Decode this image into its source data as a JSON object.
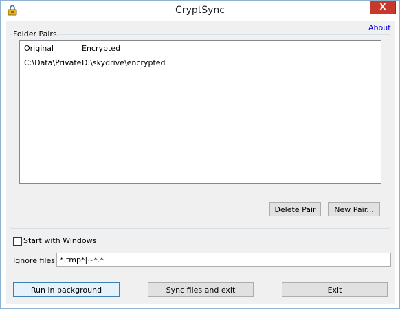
{
  "window": {
    "title": "CryptSync",
    "close_glyph": "X"
  },
  "about_link": "About",
  "folder_pairs": {
    "group_label": "Folder Pairs",
    "columns": [
      "Original",
      "Encrypted"
    ],
    "rows": [
      {
        "original": "C:\\Data\\Private",
        "encrypted": "D:\\skydrive\\encrypted"
      }
    ],
    "delete_button": "Delete Pair",
    "new_button": "New Pair..."
  },
  "options": {
    "start_with_windows_label": "Start with Windows",
    "start_with_windows_checked": false,
    "ignore_label": "Ignore files:",
    "ignore_value": "*.tmp*|~*.*"
  },
  "buttons": {
    "run_background": "Run in background",
    "sync_exit": "Sync files and exit",
    "exit": "Exit"
  },
  "colors": {
    "close_button": "#c7392a",
    "link": "#0000ee",
    "default_button_border": "#3c7fb1"
  },
  "icons": {
    "app": "lock-sync-icon",
    "close": "close-icon"
  }
}
